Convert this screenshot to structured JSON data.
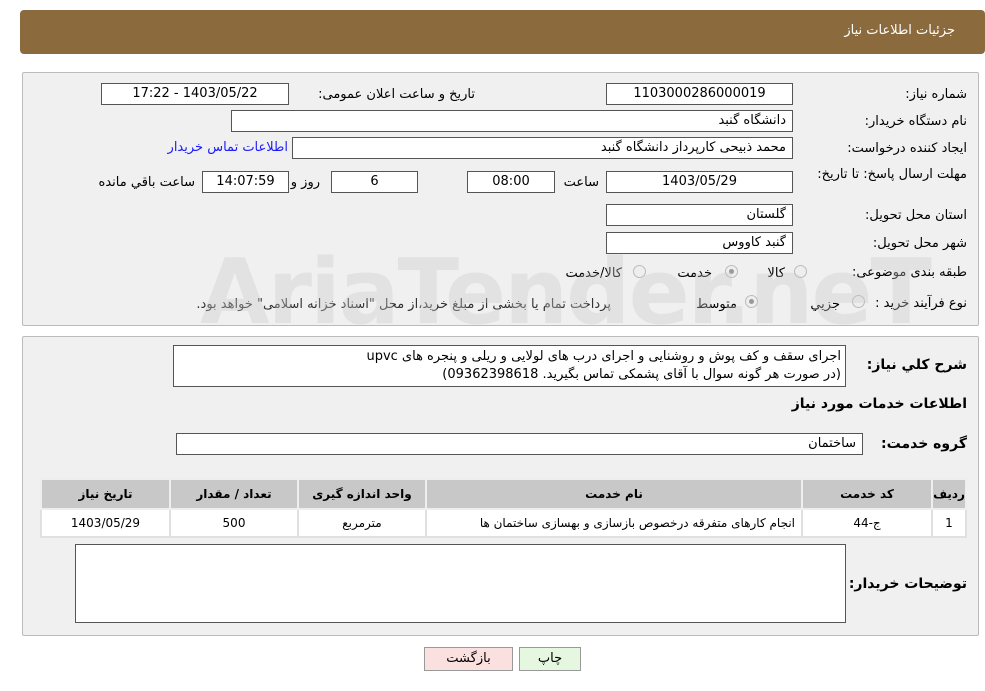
{
  "header": {
    "title": "جزئیات اطلاعات نیاز"
  },
  "form": {
    "need_number_label": "شماره نیاز:",
    "need_number": "1103000286000019",
    "announce_label": "تاریخ و ساعت اعلان عمومی:",
    "announce_value": "1403/05/22 - 17:22",
    "buyer_label": "نام دستگاه خریدار:",
    "buyer": "دانشگاه گنبد",
    "creator_label": "ایجاد کننده درخواست:",
    "creator": "محمد ذبیحی کارپرداز دانشگاه گنبد",
    "contact_link": "اطلاعات تماس خریدار",
    "deadline_label": "مهلت ارسال پاسخ: تا تاریخ:",
    "deadline_date": "1403/05/29",
    "time_label": "ساعت",
    "deadline_time": "08:00",
    "days": "6",
    "days_label": "روز و",
    "remaining": "14:07:59",
    "remaining_label": "ساعت باقي مانده",
    "province_label": "استان محل تحویل:",
    "province": "گلستان",
    "city_label": "شهر محل تحویل:",
    "city": "گنبد کاووس",
    "category_label": "طبقه بندی موضوعی:",
    "category_options": [
      "کالا",
      "خدمت",
      "کالا/خدمت"
    ],
    "category_selected": "خدمت",
    "process_label": "نوع فرآیند خرید :",
    "process_options": [
      "جزیي",
      "متوسط"
    ],
    "process_selected": "متوسط",
    "payment_note": "پرداخت تمام یا بخشی از مبلغ خرید،از محل \"اسناد خزانه اسلامی\" خواهد بود."
  },
  "details": {
    "desc_label": "شرح کلي نیاز:",
    "desc_line1": "اجرای سقف و کف پوش و روشنایی و اجرای درب های لولایی و ریلی و پنجره های upvc",
    "desc_line2": "(در صورت هر گونه سوال با آقای پشمکی تماس بگیرید. 09362398618)",
    "services_title": "اطلاعات خدمات مورد نیاز",
    "group_label": "گروه خدمت:",
    "group": "ساختمان",
    "table": {
      "headers": [
        "ردیف",
        "کد خدمت",
        "نام خدمت",
        "واحد اندازه گیری",
        "تعداد / مقدار",
        "تاریخ نیاز"
      ],
      "rows": [
        [
          "1",
          "ج-44",
          "انجام کارهای متفرقه درخصوص بازسازی و بهسازی ساختمان ها",
          "مترمربع",
          "500",
          "1403/05/29"
        ]
      ]
    },
    "buyer_notes_label": "توضیحات خریدار:"
  },
  "buttons": {
    "print": "چاپ",
    "back": "بازگشت"
  },
  "watermark": "AriaTender.neT"
}
